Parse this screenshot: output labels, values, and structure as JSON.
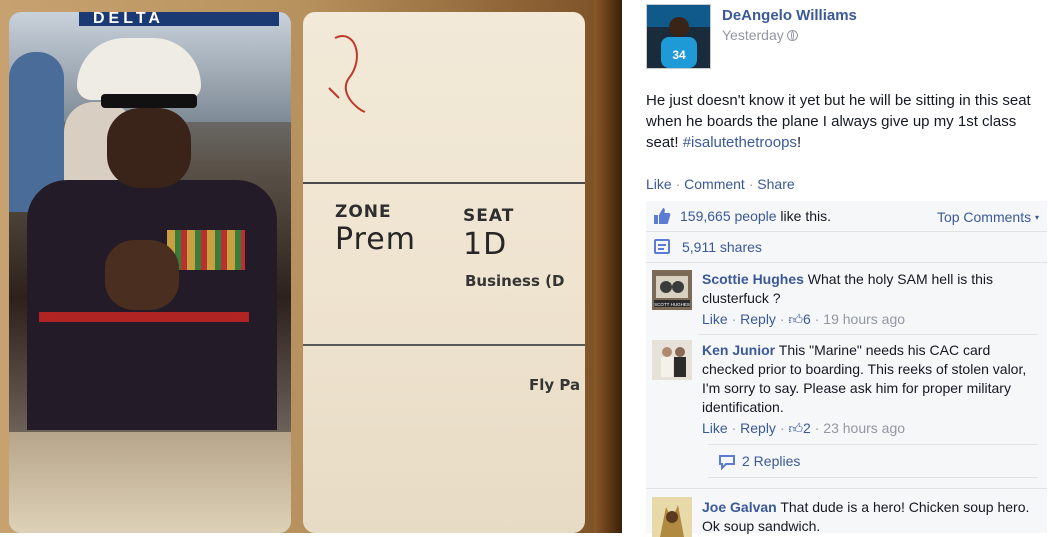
{
  "photo": {
    "airline_text": "DELTA",
    "pass_zone_label": "ZONE",
    "pass_zone_value": "Prem",
    "pass_seat_label": "SEAT",
    "pass_seat_value": "1D",
    "pass_class": "Business (D",
    "pass_fly": "Fly Pa"
  },
  "post": {
    "author": "DeAngelo Williams",
    "timestamp": "Yesterday",
    "privacy_icon": "globe-icon",
    "text_before_tag": "He just doesn't know it yet but he will be sitting in this seat when he boards the plane I always give up my 1st class seat! ",
    "hashtag": "#isalutethetroops",
    "text_after_tag": "!",
    "actions": {
      "like": "Like",
      "comment": "Comment",
      "share": "Share",
      "sep": "·"
    },
    "avatar_jersey_number": "34"
  },
  "ufi": {
    "likes_count": "159,665 people",
    "likes_suffix": " like this.",
    "top_comments": "Top Comments",
    "shares": "5,911 shares",
    "replies": "2 Replies"
  },
  "comments": [
    {
      "name": "Scottie Hughes",
      "text": "What the holy SAM hell is this clusterfuck ?",
      "like": "Like",
      "reply": "Reply",
      "likes": "6",
      "time": "19 hours ago",
      "avatar_text": "SCOTT HUGHES"
    },
    {
      "name": "Ken Junior",
      "text": "This \"Marine\" needs his CAC card checked prior to boarding. This reeks of stolen valor, I'm sorry to say. Please ask him for proper military identification.",
      "like": "Like",
      "reply": "Reply",
      "likes": "2",
      "time": "23 hours ago"
    },
    {
      "name": "Joe Galvan",
      "text": "That dude is a hero! Chicken soup hero. Ok soup sandwich."
    }
  ],
  "colors": {
    "link": "#3b5998",
    "meta_grey": "#9197a3",
    "ufi_bg": "#f6f7f9"
  }
}
